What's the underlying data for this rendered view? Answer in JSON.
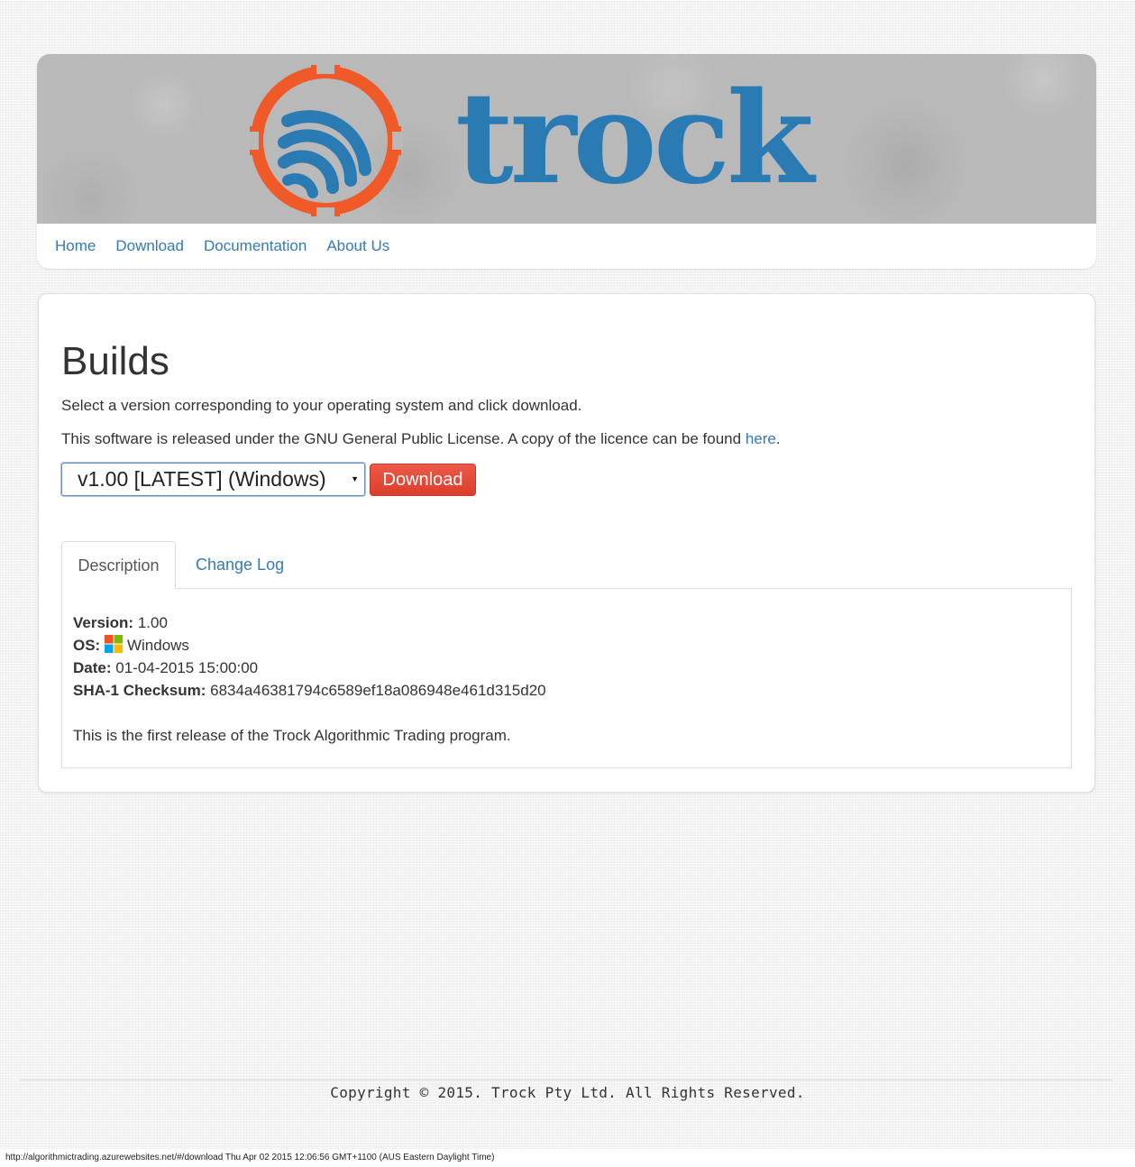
{
  "brand": {
    "name": "trock",
    "logo_icon": "trock-logo-icon",
    "logo_colors": {
      "ring": "#f05a28",
      "waves": "#2a7ab4"
    }
  },
  "nav": {
    "items": [
      {
        "label": "Home"
      },
      {
        "label": "Download"
      },
      {
        "label": "Documentation"
      },
      {
        "label": "About Us"
      }
    ]
  },
  "main": {
    "title": "Builds",
    "intro": "Select a version corresponding to your operating system and click download.",
    "license_text": "This software is released under the GNU General Public License. A copy of the licence can be found ",
    "license_link": "here",
    "license_end": ".",
    "version_select": {
      "selected": "v1.00 [LATEST] (Windows)"
    },
    "download_button": "Download",
    "download_button_color": "#e74c3c",
    "tabs": [
      {
        "label": "Description",
        "active": true
      },
      {
        "label": "Change Log",
        "active": false
      }
    ],
    "description": {
      "version_label": "Version:",
      "version_value": "1.00",
      "os_label": "OS:",
      "os_icon": "windows-icon",
      "os_value": "Windows",
      "date_label": "Date:",
      "date_value": "01-04-2015 15:00:00",
      "checksum_label": "SHA-1 Checksum:",
      "checksum_value": "6834a46381794c6589ef18a086948e461d315d20",
      "release_note": "This is the first release of the Trock Algorithmic Trading program."
    }
  },
  "footer": {
    "copyright": "Copyright © 2015. Trock Pty Ltd. All Rights Reserved."
  },
  "status_bar": {
    "text": "http://algorithmictrading.azurewebsites.net/#/download Thu Apr 02 2015 12:06:56 GMT+1100 (AUS Eastern Daylight Time)"
  }
}
